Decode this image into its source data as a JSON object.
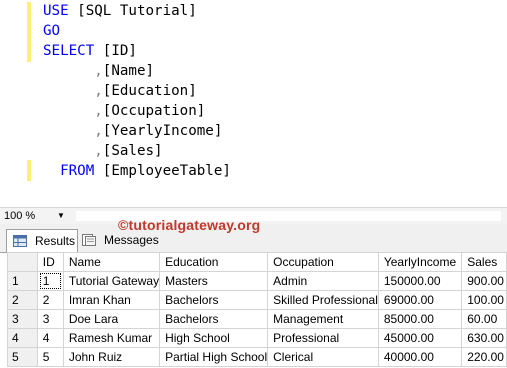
{
  "editor": {
    "lines": [
      {
        "kw": "USE",
        "rest": " [SQL Tutorial]"
      },
      {
        "kw": "GO",
        "rest": ""
      },
      {
        "kw": "SELECT",
        "rest": " [ID]"
      },
      {
        "indent": "      ",
        "comma": ",",
        "rest": "[Name]"
      },
      {
        "indent": "      ",
        "comma": ",",
        "rest": "[Education]"
      },
      {
        "indent": "      ",
        "comma": ",",
        "rest": "[Occupation]"
      },
      {
        "indent": "      ",
        "comma": ",",
        "rest": "[YearlyIncome]"
      },
      {
        "indent": "      ",
        "comma": ",",
        "rest": "[Sales]"
      },
      {
        "indent": "  ",
        "kw": "FROM",
        "rest": " [EmployeeTable]"
      }
    ]
  },
  "zoom": {
    "value": "100 %",
    "arrow": "▼"
  },
  "tabs": {
    "results": "Results",
    "messages": "Messages"
  },
  "watermark": "©tutorialgateway.org",
  "grid": {
    "columns": [
      "",
      "ID",
      "Name",
      "Education",
      "Occupation",
      "YearlyIncome",
      "Sales"
    ],
    "rows": [
      [
        "1",
        "1",
        "Tutorial Gateway",
        "Masters",
        "Admin",
        "150000.00",
        "900.00"
      ],
      [
        "2",
        "2",
        "Imran Khan",
        "Bachelors",
        "Skilled Professional",
        "69000.00",
        "100.00"
      ],
      [
        "3",
        "3",
        "Doe Lara",
        "Bachelors",
        "Management",
        "85000.00",
        "60.00"
      ],
      [
        "4",
        "4",
        "Ramesh Kumar",
        "High School",
        "Professional",
        "45000.00",
        "630.00"
      ],
      [
        "5",
        "5",
        "John Ruiz",
        "Partial High School",
        "Clerical",
        "40000.00",
        "220.00"
      ]
    ]
  },
  "colors": {
    "keyword": "#0000ff",
    "comma": "#808080",
    "watermark": "#c0392b"
  }
}
